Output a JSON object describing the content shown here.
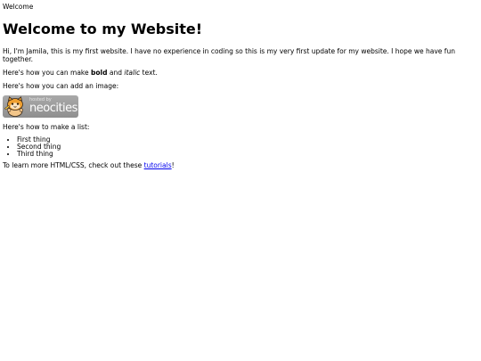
{
  "tab_title": "Welcome",
  "heading": "Welcome to my Website!",
  "intro": "Hi, I'm Jamila, this is my first website. I have no experience in coding so this is my very first update for my website. I hope we have fun together.",
  "format_line": {
    "before": "Here's how you can make ",
    "bold": "bold",
    "middle": " and ",
    "italic": "italic",
    "after": " text."
  },
  "image_line": "Here's how you can add an image:",
  "badge": {
    "small_text": "hosted by",
    "brand_text": "neocities",
    "icon": "neocities-cat-icon"
  },
  "list_intro": "Here's how to make a list:",
  "list_items": [
    "First thing",
    "Second thing",
    "Third thing"
  ],
  "learn_line": {
    "before": "To learn more HTML/CSS, check out these ",
    "link": "tutorials",
    "after": "!"
  },
  "colors": {
    "link": "#0000ee",
    "badge_bg": "#9c9c9c",
    "cat_orange": "#f0a030"
  }
}
